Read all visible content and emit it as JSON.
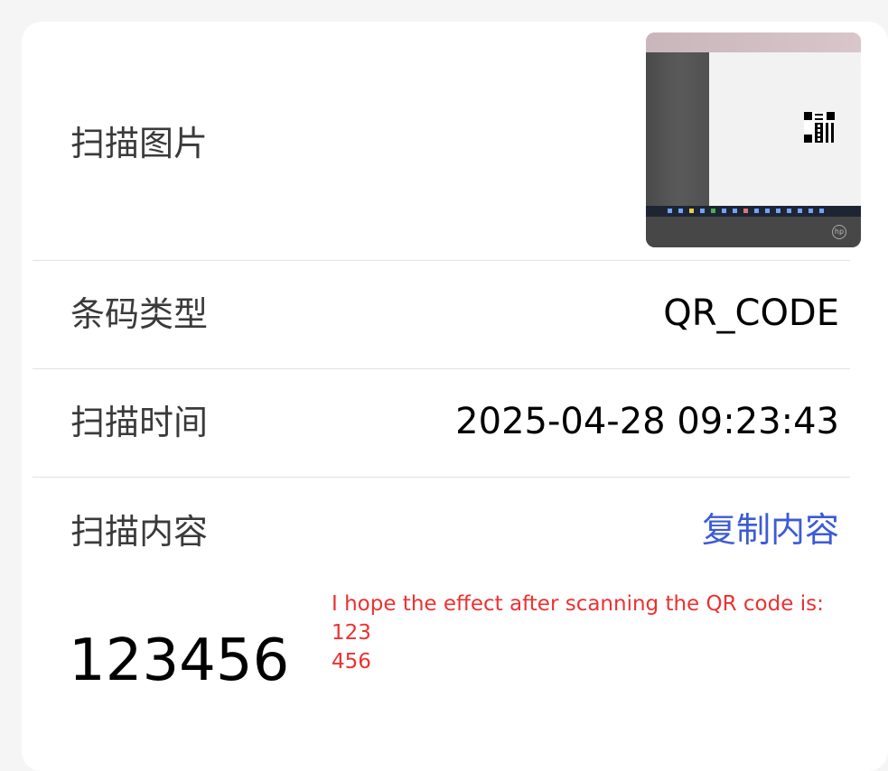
{
  "scan_image": {
    "label": "扫描图片",
    "thumbnail": "qr-code-photo-thumbnail"
  },
  "barcode_type": {
    "label": "条码类型",
    "value": "QR_CODE"
  },
  "scan_time": {
    "label": "扫描时间",
    "value": "2025-04-28 09:23:43"
  },
  "scan_content": {
    "label": "扫描内容",
    "copy_label": "复制内容",
    "value": "123456"
  },
  "annotation": {
    "line1": "I hope the effect after scanning the QR code is:",
    "line2": "123",
    "line3": "456"
  },
  "colors": {
    "background": "#f5f5f5",
    "card": "#ffffff",
    "link": "#3c5bd6",
    "annotation": "#ee3030"
  }
}
